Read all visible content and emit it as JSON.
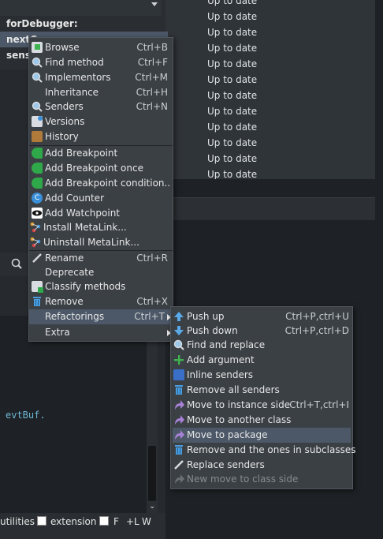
{
  "status_list": {
    "rows": [
      "Up to date",
      "Up to date",
      "Up to date",
      "Up to date",
      "Up to date",
      "Up to date",
      "Up to date",
      "Up to date",
      "Up to date",
      "Up to date",
      "Up to date",
      "Up to date"
    ]
  },
  "method_list": {
    "items": [
      "forDebugger:",
      "nextC",
      "sens"
    ]
  },
  "code": {
    "text": "evtBuf."
  },
  "bottom_bar": {
    "utilities_label": "utilities",
    "extension_label": "extension",
    "f_label": "F",
    "l_label": "+L",
    "w_label": "W"
  },
  "context_menu": {
    "items": [
      {
        "label": "Browse",
        "shortcut": "Ctrl+B",
        "icon": "browse-icon"
      },
      {
        "label": "Find method",
        "shortcut": "Ctrl+F",
        "icon": "search-icon"
      },
      {
        "label": "Implementors",
        "shortcut": "Ctrl+M",
        "icon": "search-icon"
      },
      {
        "label": "Inheritance",
        "shortcut": "Ctrl+H",
        "icon": ""
      },
      {
        "label": "Senders",
        "shortcut": "Ctrl+N",
        "icon": "search-icon"
      },
      {
        "label": "Versions",
        "shortcut": "",
        "icon": "versions-icon"
      },
      {
        "label": "History",
        "shortcut": "",
        "icon": "history-icon"
      },
      {
        "label": "Add Breakpoint",
        "shortcut": "",
        "icon": "breakpoint-icon"
      },
      {
        "label": "Add Breakpoint once",
        "shortcut": "",
        "icon": "breakpoint-icon"
      },
      {
        "label": "Add Breakpoint condition..",
        "shortcut": "",
        "icon": "breakpoint-icon"
      },
      {
        "label": "Add Counter",
        "shortcut": "",
        "icon": "counter-icon"
      },
      {
        "label": "Add Watchpoint",
        "shortcut": "",
        "icon": "eye-icon"
      },
      {
        "label": "Install MetaLink...",
        "shortcut": "",
        "icon": "metalink-icon"
      },
      {
        "label": "Uninstall MetaLink...",
        "shortcut": "",
        "icon": "metalink-icon"
      },
      {
        "label": "Rename",
        "shortcut": "Ctrl+R",
        "icon": "pencil-icon"
      },
      {
        "label": "Deprecate",
        "shortcut": "",
        "icon": ""
      },
      {
        "label": "Classify methods",
        "shortcut": "",
        "icon": "classify-icon"
      },
      {
        "label": "Remove",
        "shortcut": "Ctrl+X",
        "icon": "trash-icon"
      },
      {
        "label": "Refactorings",
        "shortcut": "Ctrl+T",
        "icon": ""
      },
      {
        "label": "Extra",
        "shortcut": "",
        "icon": ""
      }
    ]
  },
  "submenu": {
    "items": [
      {
        "label": "Push up",
        "shortcut": "Ctrl+P,ctrl+U",
        "icon": "arrow-up-icon"
      },
      {
        "label": "Push down",
        "shortcut": "Ctrl+P,ctrl+D",
        "icon": "arrow-down-icon"
      },
      {
        "label": "Find and replace",
        "shortcut": "",
        "icon": "search-icon"
      },
      {
        "label": "Add argument",
        "shortcut": "",
        "icon": "plus-icon"
      },
      {
        "label": "Inline senders",
        "shortcut": "",
        "icon": "inline-icon"
      },
      {
        "label": "Remove all senders",
        "shortcut": "",
        "icon": "trash-icon"
      },
      {
        "label": "Move to instance side",
        "shortcut": "Ctrl+T,ctrl+I",
        "icon": "move-icon"
      },
      {
        "label": "Move to another class",
        "shortcut": "",
        "icon": "move-icon"
      },
      {
        "label": "Move to package",
        "shortcut": "",
        "icon": "move-icon"
      },
      {
        "label": "Remove and the ones in subclasses",
        "shortcut": "",
        "icon": "trash-icon"
      },
      {
        "label": "Replace senders",
        "shortcut": "",
        "icon": "pencil-icon"
      },
      {
        "label": "New move to class side",
        "shortcut": "",
        "icon": "move-icon"
      }
    ]
  },
  "colors": {
    "highlight": "#4c5868",
    "menu_bg": "#3b4045",
    "background": "#262a2e",
    "code_text": "#6fb6d6"
  }
}
